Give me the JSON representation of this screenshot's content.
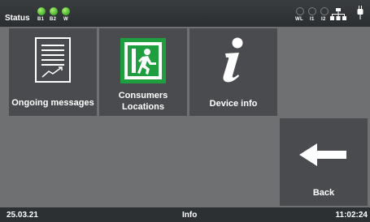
{
  "statusbar": {
    "status_label": "Status",
    "indicators_left": [
      "B1",
      "B2",
      "W"
    ],
    "indicators_right": [
      "WL",
      "I1",
      "I2"
    ],
    "icons": [
      "network-icon",
      "plug-icon"
    ],
    "led_on_color": "#47b12a"
  },
  "tiles": {
    "ongoing_messages": "Ongoing messages",
    "consumers_locations_line1": "Consumers",
    "consumers_locations_line2": "Locations",
    "device_info": "Device info",
    "back": "Back"
  },
  "icons": {
    "ongoing_messages": "document-chart-icon",
    "consumers_locations": "emergency-exit-icon",
    "device_info": "info-icon",
    "back": "arrow-left-icon"
  },
  "footer": {
    "date": "25.03.21",
    "page_title": "Info",
    "time": "11:02:24"
  },
  "colors": {
    "tile_bg": "#4a4b4e",
    "content_bg": "#6f7072",
    "exit_green": "#1e9e3e"
  }
}
